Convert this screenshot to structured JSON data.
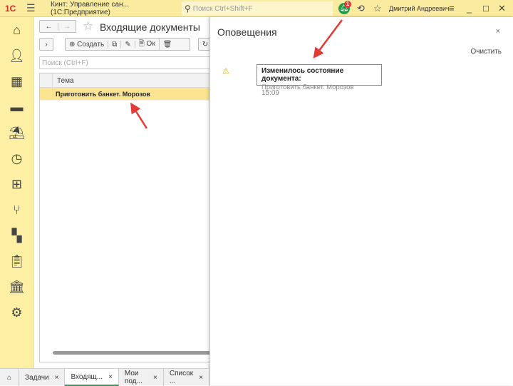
{
  "app": {
    "logo": "1С",
    "title": "Кинт: Управление сан...  (1С:Предприятие)",
    "search_placeholder": "Поиск Ctrl+Shift+F",
    "notification_count": "1",
    "user": "Дмитрий Андреевич"
  },
  "sidebar": {
    "icons": [
      "home-icon",
      "user-icon",
      "calendar-icon",
      "card-icon",
      "lamp-icon",
      "clock-icon",
      "plus-icon",
      "fork-knife-icon",
      "structure-icon",
      "clipboard-icon",
      "bank-icon",
      "gears-icon"
    ]
  },
  "form": {
    "title": "Входящие документы",
    "create": "Создать",
    "ok": "Ок",
    "search_placeholder": "Поиск (Ctrl+F)",
    "column": "Тема",
    "rows": [
      "Приготовить банкет. Морозов"
    ]
  },
  "panel": {
    "title": "Оповещения",
    "close": "×",
    "clear": "Очистить",
    "notification": {
      "heading": "Изменилось состояние документа:",
      "text": "Приготовить банкет. Морозов",
      "time": "15:09"
    }
  },
  "tabs": [
    {
      "label": "Задачи"
    },
    {
      "label": "Входящ..."
    },
    {
      "label": "Мои под..."
    },
    {
      "label": "Список ..."
    }
  ],
  "colors": {
    "accent": "#fbeb9f",
    "arrow": "#e53935",
    "selected_row": "#fbe590"
  }
}
